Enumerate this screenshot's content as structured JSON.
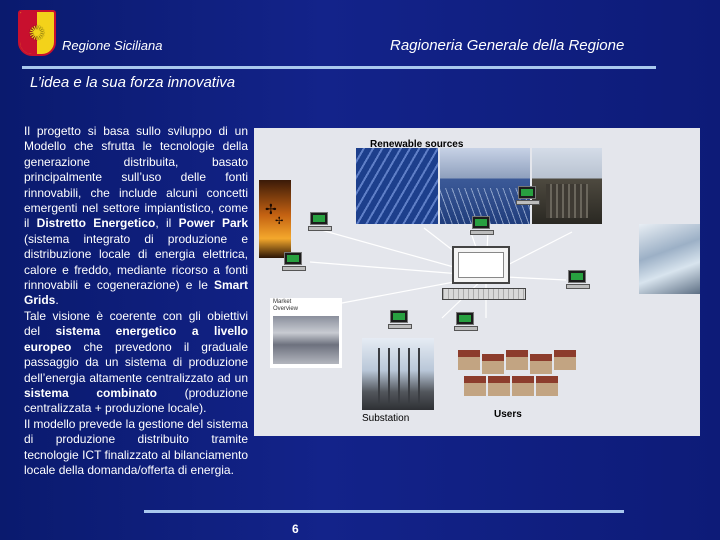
{
  "header": {
    "left_title": "Regione Siciliana",
    "right_title": "Ragioneria Generale della Regione"
  },
  "slide": {
    "subtitle": "L’idea e la sua forza innovativa",
    "page_number": "6"
  },
  "body": {
    "p1_a": "Il progetto si basa sullo sviluppo di un Modello che sfrutta le tecnologie della generazione distribuita, basato principalmente sull’uso delle fonti rinnovabili, che include alcuni concetti emergenti nel settore impiantistico, come il ",
    "p1_b": "Distretto Energetico",
    "p1_c": ", il ",
    "p1_d": "Power Park",
    "p1_e": " (sistema integrato di produzione e distribuzione locale di energia elettrica, calore e freddo, mediante ricorso a fonti rinnovabili e cogenerazione) e le ",
    "p1_f": "Smart Grids",
    "p1_g": ".",
    "p2_a": "Tale visione è coerente con gli obiettivi del ",
    "p2_b": "sistema energetico a livello europeo",
    "p2_c": " che prevedono il graduale passaggio da un sistema di produzione dell’energia altamente centralizzato ad un ",
    "p2_d": "sistema combinato",
    "p2_e": " (produzione centralizzata + produzione locale).",
    "p3": "Il modello prevede la gestione del sistema di produzione distribuito tramite tecnologie ICT finalizzato al bilanciamento locale della domanda/offerta di energia."
  },
  "diagram": {
    "renewable_label": "Renewable sources",
    "substation_label": "Substation",
    "users_label": "Users",
    "control_room_caption": "Market\nOverview"
  },
  "colors": {
    "background": "#13238a",
    "rule": "#a9c8ee",
    "text": "#ffffff"
  }
}
